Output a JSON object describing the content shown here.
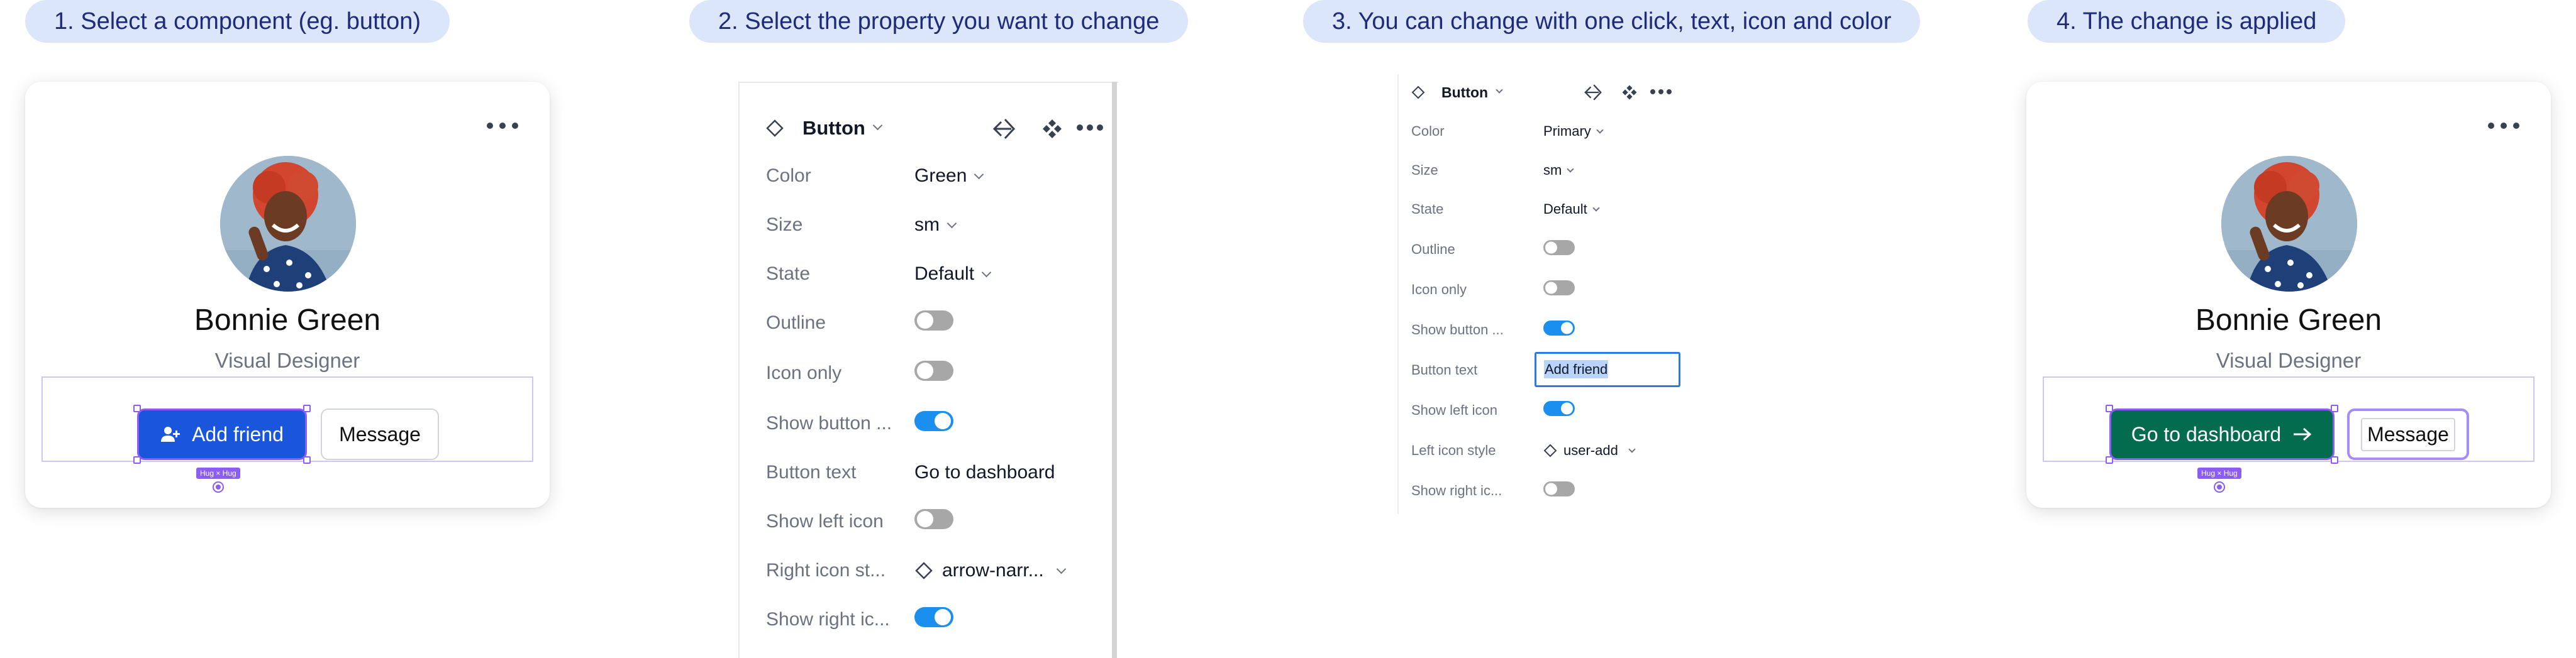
{
  "steps": [
    "1. Select a component (eg. button)",
    "2. Select the property you want to change",
    "3. You can change with one click, text, icon and color",
    "4. The change is applied"
  ],
  "card_before": {
    "name": "Bonnie Green",
    "role": "Visual Designer",
    "primary_button": "Add friend",
    "primary_icon": "user-add-icon",
    "secondary_button": "Message",
    "hug_tag": "Hug × Hug",
    "primary_color": "#1a56db"
  },
  "panel2": {
    "component": "Button",
    "properties": [
      {
        "label": "Color",
        "value": "Green",
        "kind": "dropdown"
      },
      {
        "label": "Size",
        "value": "sm",
        "kind": "dropdown"
      },
      {
        "label": "State",
        "value": "Default",
        "kind": "dropdown"
      },
      {
        "label": "Outline",
        "value": "off",
        "kind": "toggle"
      },
      {
        "label": "Icon only",
        "value": "off",
        "kind": "toggle"
      },
      {
        "label": "Show button ...",
        "value": "on",
        "kind": "toggle"
      },
      {
        "label": "Button text",
        "value": "Go to dashboard",
        "kind": "text"
      },
      {
        "label": "Show left icon",
        "value": "off",
        "kind": "toggle"
      },
      {
        "label": "Right icon st...",
        "value": "arrow-narr...",
        "kind": "icon-dropdown"
      },
      {
        "label": "Show right ic...",
        "value": "on",
        "kind": "toggle"
      }
    ]
  },
  "panel3": {
    "component": "Button",
    "properties": [
      {
        "label": "Color",
        "value": "Primary",
        "kind": "dropdown"
      },
      {
        "label": "Size",
        "value": "sm",
        "kind": "dropdown"
      },
      {
        "label": "State",
        "value": "Default",
        "kind": "dropdown"
      },
      {
        "label": "Outline",
        "value": "off",
        "kind": "toggle"
      },
      {
        "label": "Icon only",
        "value": "off",
        "kind": "toggle"
      },
      {
        "label": "Show button ...",
        "value": "on",
        "kind": "toggle"
      },
      {
        "label": "Button text",
        "value": "Add friend",
        "kind": "text-editing"
      },
      {
        "label": "Show left icon",
        "value": "on",
        "kind": "toggle"
      },
      {
        "label": "Left icon style",
        "value": "user-add",
        "kind": "icon-dropdown"
      },
      {
        "label": "Show right ic...",
        "value": "off",
        "kind": "toggle"
      }
    ]
  },
  "card_after": {
    "name": "Bonnie Green",
    "role": "Visual Designer",
    "primary_button": "Go to dashboard",
    "primary_icon": "arrow-right-icon",
    "secondary_button": "Message",
    "hug_tag": "Hug × Hug",
    "primary_color": "#046c4e"
  },
  "colors": {
    "pill_bg": "#dbe6fb",
    "pill_text": "#1e2a7a",
    "toggle_on": "#1a8ff0",
    "toggle_off": "#a7a7a7",
    "selection": "#8b5cf6"
  }
}
